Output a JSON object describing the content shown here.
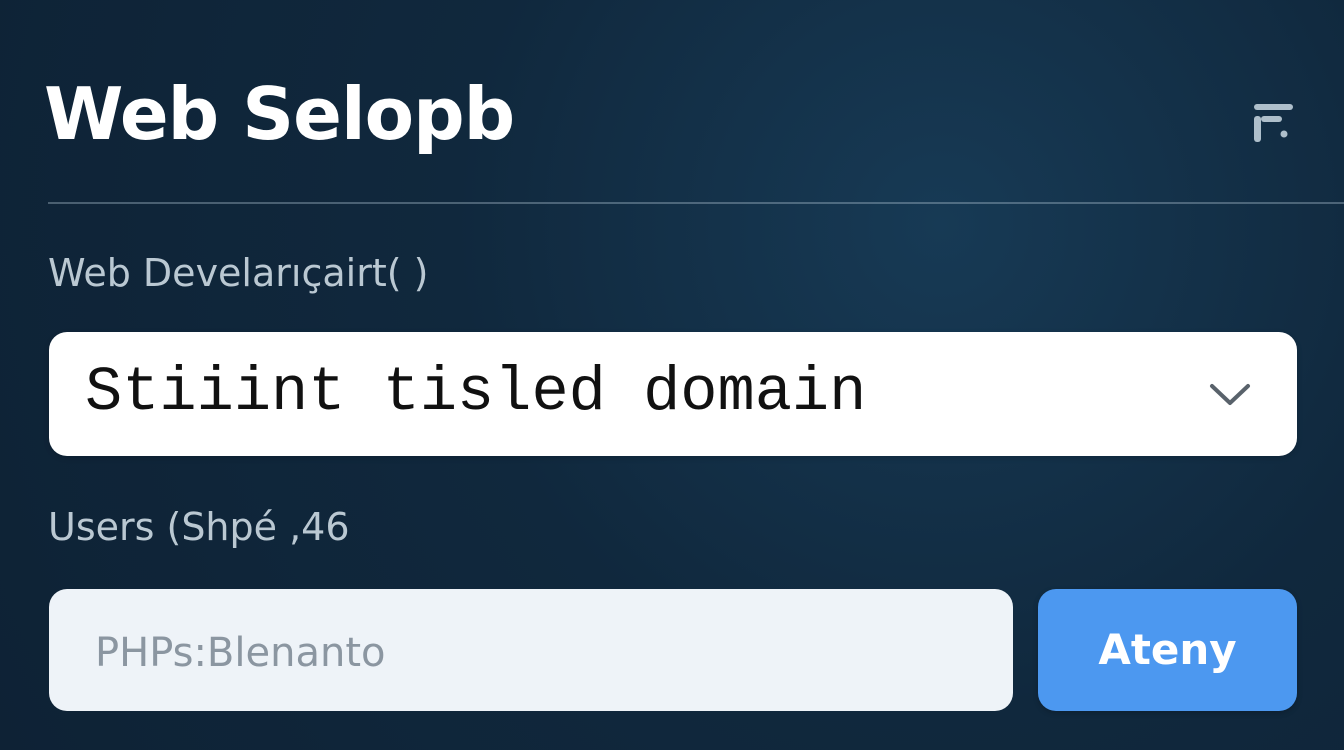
{
  "header": {
    "title": "Web Selopb",
    "menu_icon": "filter-icon"
  },
  "form": {
    "domain_label": "Web Develarıçairt( )",
    "domain_select": {
      "value": "Stiiint tisled domain",
      "icon": "chevron-down-icon"
    },
    "users_label": "Users (Shpé ,46",
    "users_input": {
      "value": "PHPs:Blenanto"
    },
    "apply_button_label": "Ateny"
  },
  "colors": {
    "background": "#10283d",
    "accent": "#4c98f0",
    "text_primary": "#ffffff",
    "text_secondary": "#bac8d2"
  }
}
